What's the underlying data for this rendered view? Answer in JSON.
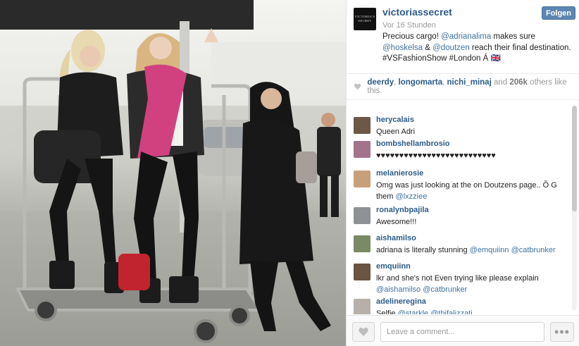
{
  "post": {
    "username": "victoriassecret",
    "brand_logo_lines": [
      "VICTORIA'S",
      "SECRET"
    ],
    "time": "Vor 16 Stunden",
    "follow_label": "Folgen",
    "caption_parts": [
      {
        "t": "Precious cargo! ",
        "m": false
      },
      {
        "t": "@adrianalima",
        "m": true
      },
      {
        "t": " makes sure ",
        "m": false
      },
      {
        "t": "@hoskelsa",
        "m": true
      },
      {
        "t": " & ",
        "m": false
      },
      {
        "t": "@doutzen",
        "m": true
      },
      {
        "t": " reach their final destination. #VSFashionShow #London Á ",
        "m": false
      },
      {
        "t": "🇬🇧",
        "m": false
      }
    ]
  },
  "likes": {
    "users": [
      "deerdy",
      "longomarta",
      "nichi_minaj"
    ],
    "and_text": "and",
    "count": "206k",
    "suffix": "others like this."
  },
  "comments": [
    {
      "user": "herycalais",
      "parts": [
        {
          "t": "Queen Adri",
          "m": false
        }
      ],
      "avatar_color": "#6b5846"
    },
    {
      "user": "bombshellambrosio",
      "parts": [
        {
          "t": "♥♥♥♥♥♥♥♥♥♥♥♥♥♥♥♥♥♥♥♥♥♥♥♥♥♥",
          "m": false
        }
      ],
      "avatar_color": "#a2748c"
    },
    {
      "user": "melanierosie",
      "parts": [
        {
          "t": "Omg was just looking at the on Doutzens page.. Õ  G them ",
          "m": false
        },
        {
          "t": "@lxzziee",
          "m": true
        }
      ],
      "avatar_color": "#c89f7b"
    },
    {
      "user": "ronalynbpajila",
      "parts": [
        {
          "t": "Awesome!!!",
          "m": false
        }
      ],
      "avatar_color": "#8e9296"
    },
    {
      "user": "aishamilso",
      "parts": [
        {
          "t": "adriana is literally stunning ",
          "m": false
        },
        {
          "t": "@emquiinn",
          "m": true
        },
        {
          "t": " ",
          "m": false
        },
        {
          "t": "@catbrunker",
          "m": true
        }
      ],
      "avatar_color": "#7a8a64"
    },
    {
      "user": "emquiinn",
      "parts": [
        {
          "t": "lkr and she's not Even trying like please explain ",
          "m": false
        },
        {
          "t": "@aishamilso",
          "m": true
        },
        {
          "t": " ",
          "m": false
        },
        {
          "t": "@catbrunker",
          "m": true
        }
      ],
      "avatar_color": "#6a5540"
    },
    {
      "user": "adelineregina",
      "parts": [
        {
          "t": "Selfie ",
          "m": false
        },
        {
          "t": "@starkle",
          "m": true
        },
        {
          "t": " ",
          "m": false
        },
        {
          "t": "@thifalizzati",
          "m": true
        }
      ],
      "avatar_color": "#b7b0aa"
    }
  ],
  "footer": {
    "comment_placeholder": "Leave a comment...",
    "more_label": "•••"
  },
  "icons": {
    "like": "heart-icon",
    "more": "ellipsis-icon"
  },
  "colors": {
    "username": "#2c5b8a",
    "mention": "#3f72a0",
    "follow_bg": "#5b86b0"
  }
}
